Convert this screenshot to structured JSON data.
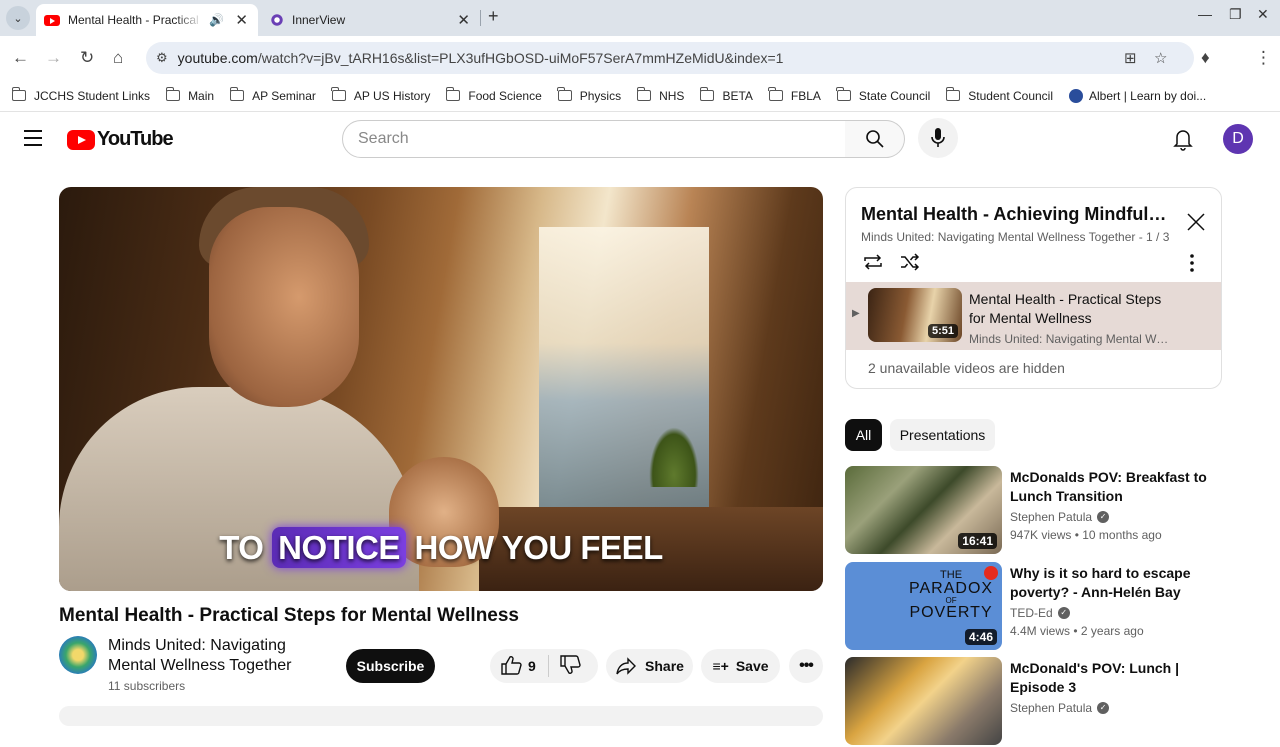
{
  "browser": {
    "tabs": [
      {
        "title": "Mental Health - Practical Steps for Mental Wellness",
        "active": true,
        "audio": true
      },
      {
        "title": "InnerView",
        "active": false
      }
    ],
    "url_host": "youtube.com",
    "url_path": "/watch?v=jBv_tARH16s&list=PLX3ufHGbOSD-uiMoF57SerA7mmHZeMidU&index=1",
    "bookmarks": [
      "JCCHS Student Links",
      "Main",
      "AP Seminar",
      "AP US History",
      "Food Science",
      "Physics",
      "NHS",
      "BETA",
      "FBLA",
      "State Council",
      "Student Council",
      "Albert | Learn by doi..."
    ]
  },
  "youtube": {
    "logo_text": "YouTube",
    "search_placeholder": "Search",
    "avatar_letter": "D"
  },
  "video": {
    "caption_prefix": "TO ",
    "caption_highlight": "NOTICE",
    "caption_suffix": " HOW YOU FEEL",
    "title": "Mental Health - Practical Steps for Mental Wellness",
    "channel": "Minds United: Navigating Mental Wellness Together",
    "subscribers": "11 subscribers",
    "subscribe_label": "Subscribe",
    "likes": "9",
    "share_label": "Share",
    "save_label": "Save"
  },
  "playlist": {
    "title": "Mental Health - Achieving Mindfulness",
    "subtitle": "Minds United: Navigating Mental Wellness Together - 1 / 3",
    "item": {
      "title": "Mental Health - Practical Steps for Mental Wellness",
      "channel": "Minds United: Navigating Mental Wellness Together",
      "duration": "5:51"
    },
    "hidden_note": "2 unavailable videos are hidden"
  },
  "chips": [
    "All",
    "Presentations"
  ],
  "recommendations": [
    {
      "title": "McDonalds POV: Breakfast to Lunch Transition",
      "channel": "Stephen Patula",
      "views": "947K views",
      "age": "10 months ago",
      "duration": "16:41"
    },
    {
      "title": "Why is it so hard to escape poverty? - Ann-Helén Bay",
      "channel": "TED-Ed",
      "views": "4.4M views",
      "age": "2 years ago",
      "duration": "4:46",
      "thumb_text": [
        "THE",
        "PARADOX",
        "OF",
        "POVERTY"
      ]
    },
    {
      "title": "McDonald's POV: Lunch | Episode 3",
      "channel": "Stephen Patula"
    }
  ],
  "colors": {
    "accent": "#ff0000",
    "avatar": "#5e35b1",
    "playlist_active": "#e6dad6"
  }
}
